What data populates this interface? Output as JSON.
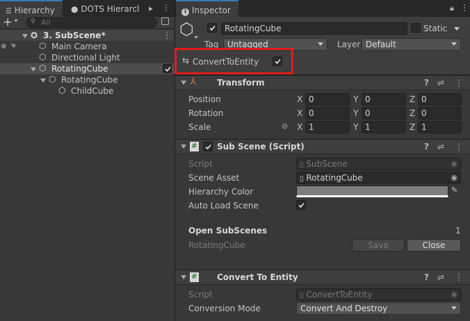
{
  "hierarchy": {
    "tabs": [
      "Hierarchy",
      "DOTS Hierarcl"
    ],
    "add_label": "+",
    "search_placeholder": "All",
    "items": [
      {
        "label": "3. SubScene*",
        "depth": 0
      },
      {
        "label": "Main Camera",
        "depth": 1
      },
      {
        "label": "Directional Light",
        "depth": 1
      },
      {
        "label": "RotatingCube",
        "depth": 1
      },
      {
        "label": "RotatingCube",
        "depth": 2
      },
      {
        "label": "ChildCube",
        "depth": 3
      }
    ]
  },
  "inspector": {
    "tab": "Inspector",
    "object_name": "RotatingCube",
    "static_label": "Static",
    "tag_label": "Tag",
    "tag_value": "Untagged",
    "layer_label": "Layer",
    "layer_value": "Default",
    "convert_label": "ConvertToEntity",
    "transform": {
      "title": "Transform",
      "rows": [
        {
          "label": "Position",
          "x": "0",
          "y": "0",
          "z": "0"
        },
        {
          "label": "Rotation",
          "x": "0",
          "y": "0",
          "z": "0"
        },
        {
          "label": "Scale",
          "x": "1",
          "y": "1",
          "z": "1"
        }
      ],
      "axes": [
        "X",
        "Y",
        "Z"
      ]
    },
    "subscene": {
      "title": "Sub Scene (Script)",
      "script_label": "Script",
      "script_value": "SubScene",
      "scene_asset_label": "Scene Asset",
      "scene_asset_value": "RotatingCube",
      "hierarchy_color_label": "Hierarchy Color",
      "auto_load_label": "Auto Load Scene",
      "open_subscenes_label": "Open SubScenes",
      "open_subscenes_count": "1",
      "open_item": "RotatingCube",
      "save_label": "Save",
      "close_label": "Close"
    },
    "convert": {
      "title": "Convert To Entity",
      "script_label": "Script",
      "script_value": "ConvertToEntity",
      "mode_label": "Conversion Mode",
      "mode_value": "Convert And Destroy"
    }
  },
  "colors": {
    "highlight_box": "#e31c1c",
    "selection": "#4d4d4d",
    "background": "#383838"
  }
}
